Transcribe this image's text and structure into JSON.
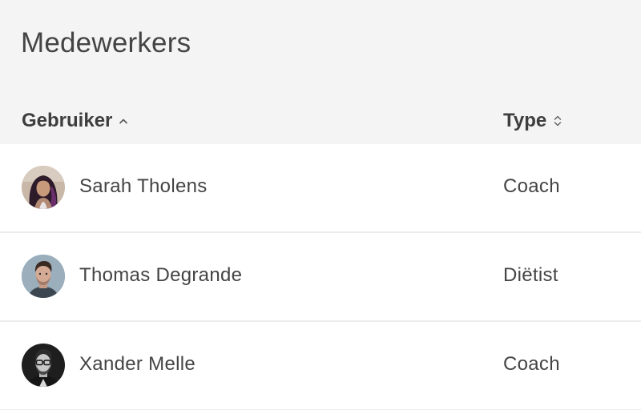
{
  "page": {
    "title": "Medewerkers"
  },
  "table": {
    "columns": [
      {
        "label": "Gebruiker",
        "sort": "ascending",
        "sort_icon": "chevron-up-icon"
      },
      {
        "label": "Type",
        "sort": "none",
        "sort_icon": "sort-updown-icon"
      }
    ],
    "rows": [
      {
        "name": "Sarah Tholens",
        "type": "Coach",
        "avatar": "avatar-woman-long-dark-hair"
      },
      {
        "name": "Thomas Degrande",
        "type": "Diëtist",
        "avatar": "avatar-man-short-hair"
      },
      {
        "name": "Xander Melle",
        "type": "Coach",
        "avatar": "avatar-man-glasses"
      }
    ]
  },
  "colors": {
    "header_background": "#f4f4f4",
    "row_background": "#ffffff",
    "row_divider": "#ececec",
    "text": "#444444"
  }
}
